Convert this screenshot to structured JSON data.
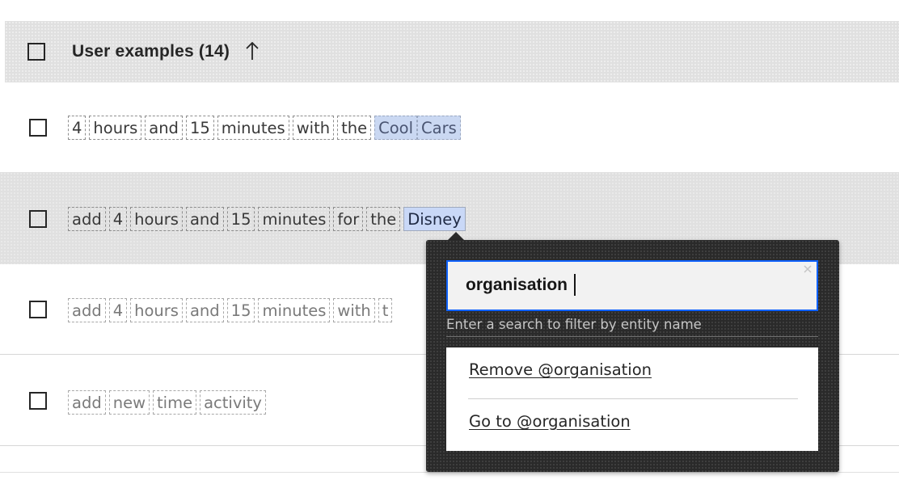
{
  "table": {
    "header": {
      "title": "User examples (14)",
      "sort_icon": "arrow-up-icon"
    },
    "rows": [
      {
        "tokens": [
          "4",
          "hours",
          "and",
          "15",
          "minutes",
          "with",
          "the",
          "Cool",
          "Cars"
        ]
      },
      {
        "tokens": [
          "add",
          "4",
          "hours",
          "and",
          "15",
          "minutes",
          "for",
          "the",
          "Disney"
        ]
      },
      {
        "tokens": [
          "add",
          "4",
          "hours",
          "and",
          "15",
          "minutes",
          "with",
          "t"
        ]
      },
      {
        "tokens": [
          "add",
          "new",
          "time",
          "activity"
        ]
      }
    ]
  },
  "popover": {
    "search": {
      "value": "organisation"
    },
    "helper_text": "Enter a search to filter by entity name",
    "menu": {
      "remove_label": "Remove @organisation",
      "goto_label": "Go to @organisation"
    }
  },
  "colors": {
    "focus_border": "#0f62fe",
    "entity_highlight": "#c9d8f7",
    "popover_bg": "#2a2a2a",
    "selected_row_bg": "#e0e0e0"
  }
}
